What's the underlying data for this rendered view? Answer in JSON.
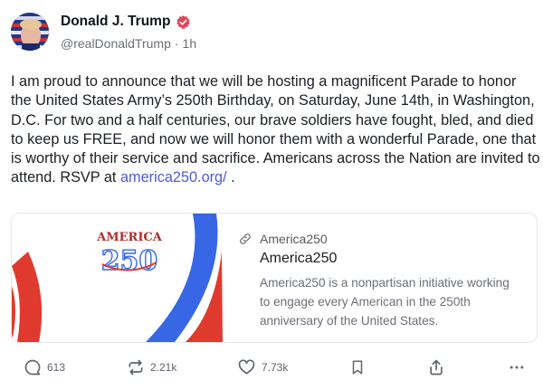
{
  "author": {
    "display_name": "Donald J. Trump",
    "handle": "@realDonaldTrump",
    "separator": "·",
    "time_ago": "1h",
    "verified_color": "#e0465d"
  },
  "post": {
    "text_before_link": "I am proud to announce that we will be hosting a magnificent Parade to honor the United States Army’s 250th Birthday, on Saturday, June 14th, in Washington, D.C. For two and a half centuries, our brave soldiers have fought, bled, and died to keep us FREE, and now we will honor them with a wonderful Parade, one that is worthy of their service and sacrifice. Americans across the Nation are invited to attend. RSVP at ",
    "link_text": "america250.org/",
    "text_after_link": " .",
    "link_color": "#4f5bd5"
  },
  "card": {
    "image_logo_word": "AMERICA",
    "image_logo_number": "250",
    "source": "America250",
    "title": "America250",
    "description": "America250 is a nonpartisan initiative working to engage every American in the 250th anniversary of the United States.",
    "stripe_blue": "#3867e5",
    "stripe_red": "#e03a2e"
  },
  "actions": {
    "reply_count": "613",
    "retruth_count": "2.21k",
    "like_count": "7.73k"
  }
}
